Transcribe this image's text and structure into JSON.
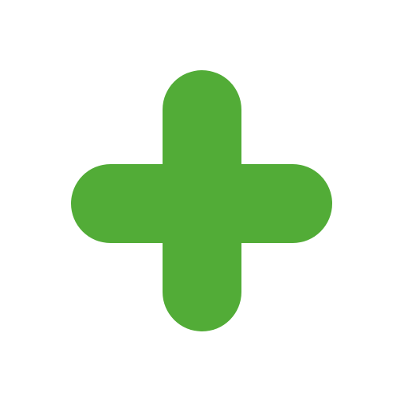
{
  "icon": {
    "name": "plus-icon",
    "color": "#52AC37",
    "background": "#FFFFFF"
  }
}
